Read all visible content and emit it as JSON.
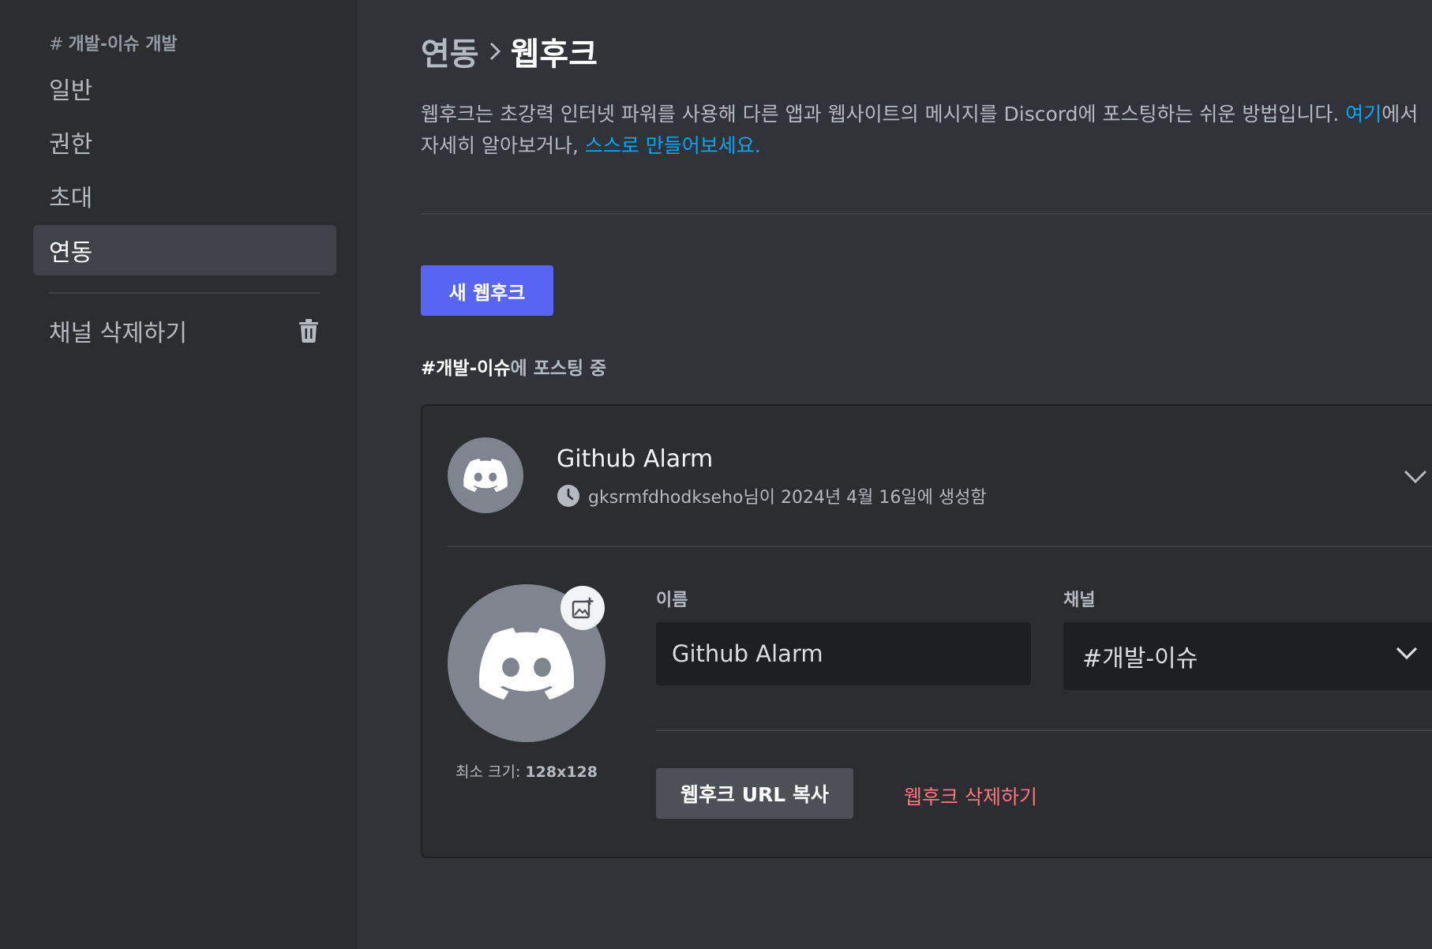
{
  "sidebar": {
    "header_hash": "#",
    "header": "개발-이슈 개발",
    "items": [
      {
        "label": "일반"
      },
      {
        "label": "권한"
      },
      {
        "label": "초대"
      },
      {
        "label": "연동"
      }
    ],
    "delete_channel": "채널 삭제하기"
  },
  "main": {
    "breadcrumb_parent": "연동",
    "breadcrumb_current": "웹후크",
    "description_line1": "웹후크는 초강력 인터넷 파워를 사용해 다른 앱과 웹사이트의 메시지를 Discord에 포스팅하는 쉬운 방법입니다.",
    "description_link1": "여기",
    "description_after_link1": "에서",
    "description_line2_prefix": "자세히 알아보거나,",
    "description_link2": "스스로 만들어보세요.",
    "new_webhook_button": "새 웹후크",
    "posting_channel": "#개발-이슈",
    "posting_suffix": "에 포스팅 중"
  },
  "webhook": {
    "name": "Github Alarm",
    "creator": "gksrmfdhodkseho",
    "created_text": "님이 2024년 4월 16일에 생성함",
    "min_size_label": "최소 크기:",
    "min_size_value": "128x128",
    "name_label": "이름",
    "name_value": "Github Alarm",
    "channel_label": "채널",
    "channel_value": "#개발-이슈",
    "copy_url_button": "웹후크 URL 복사",
    "delete_button": "웹후크 삭제하기"
  },
  "colors": {
    "accent": "#5865f2",
    "link": "#00a8fc",
    "danger": "#fa777c"
  },
  "icons": [
    "trash-icon",
    "chevron-right-icon",
    "discord-logo-icon",
    "clock-icon",
    "chevron-down-icon",
    "image-add-icon"
  ]
}
